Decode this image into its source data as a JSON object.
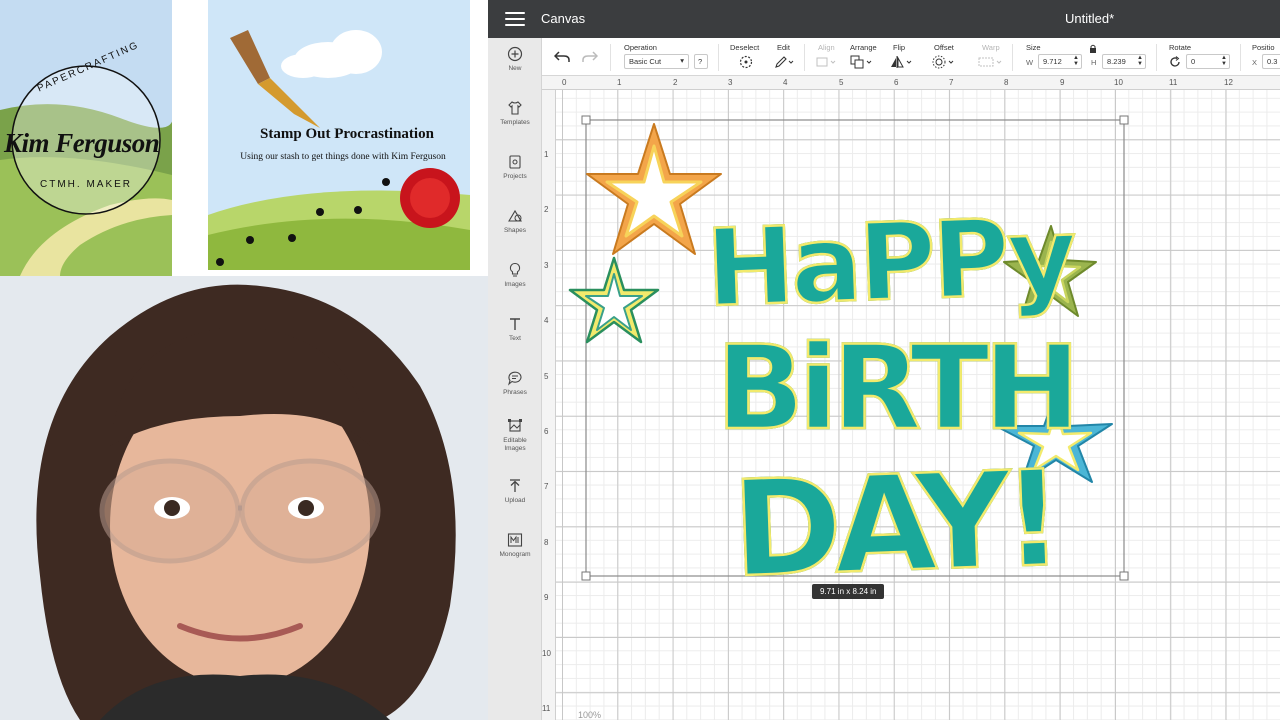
{
  "left_panel": {
    "logo": {
      "arc_text": "PAPERCRAFTING",
      "name": "Kim Ferguson",
      "sub_text": "CTMH. MAKER"
    },
    "stamp_card": {
      "title": "Stamp Out Procrastination",
      "subtitle": "Using our stash to get things done with Kim Ferguson"
    }
  },
  "app": {
    "title": "Canvas",
    "document_title": "Untitled*"
  },
  "toolbar": {
    "operation_label": "Operation",
    "operation_value": "Basic Cut",
    "help_label": "?",
    "deselect_label": "Deselect",
    "edit_label": "Edit",
    "align_label": "Align",
    "arrange_label": "Arrange",
    "flip_label": "Flip",
    "offset_label": "Offset",
    "warp_label": "Warp",
    "size_label": "Size",
    "w_label": "W",
    "w_value": "9.712",
    "h_label": "H",
    "h_value": "8.239",
    "rotate_label": "Rotate",
    "rotate_value": "0",
    "position_label": "Positio",
    "x_label": "X",
    "x_value": "0.3"
  },
  "sidebar": {
    "items": [
      {
        "label": "New",
        "icon": "plus-circle-icon"
      },
      {
        "label": "Templates",
        "icon": "shirt-icon"
      },
      {
        "label": "Projects",
        "icon": "projects-icon"
      },
      {
        "label": "Shapes",
        "icon": "shapes-icon"
      },
      {
        "label": "Images",
        "icon": "lightbulb-icon"
      },
      {
        "label": "Text",
        "icon": "text-icon"
      },
      {
        "label": "Phrases",
        "icon": "speech-bubble-icon"
      },
      {
        "label": "Editable Images",
        "icon": "editable-image-icon"
      },
      {
        "label": "Upload",
        "icon": "upload-icon"
      },
      {
        "label": "Monogram",
        "icon": "monogram-icon"
      }
    ]
  },
  "rulers": {
    "top": [
      "0",
      "1",
      "2",
      "3",
      "4",
      "5",
      "6",
      "7",
      "8",
      "9",
      "10",
      "11",
      "12"
    ],
    "left": [
      "1",
      "2",
      "3",
      "4",
      "5",
      "6",
      "7",
      "8",
      "9",
      "10",
      "11"
    ]
  },
  "canvas": {
    "size_tooltip": "9.71  in x 8.24  in",
    "zoom_text": "100%",
    "design_words": [
      "HaPPy",
      "BiRTH",
      "DAY!"
    ]
  },
  "colors": {
    "topbar": "#3b3d3f",
    "teal": "#1aa89a",
    "yellow": "#f2ea6c",
    "orange": "#f3a54a",
    "olive": "#9ab44e",
    "sky": "#4bb6d6",
    "stroke": "#137e72"
  }
}
